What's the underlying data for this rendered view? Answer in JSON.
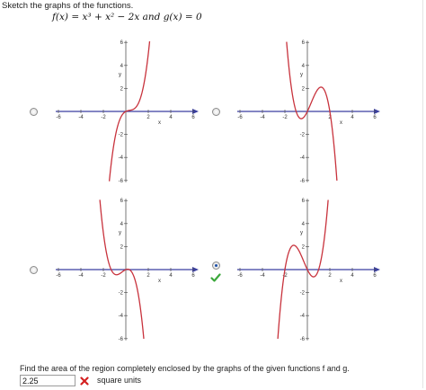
{
  "prompt": "Sketch the graphs of the functions.",
  "equation": "f(x) = x³ + x² − 2x and g(x) = 0",
  "axis": {
    "x_ticks": [
      "-6",
      "-4",
      "-2",
      "2",
      "4",
      "6"
    ],
    "y_ticks": [
      "6",
      "4",
      "2",
      "-2",
      "-4",
      "-6"
    ],
    "x_label": "x",
    "y_label": "y"
  },
  "choices": [
    {
      "id": "a",
      "selected": false,
      "correct": false
    },
    {
      "id": "b",
      "selected": false,
      "correct": false
    },
    {
      "id": "c",
      "selected": false,
      "correct": false
    },
    {
      "id": "d",
      "selected": true,
      "correct": true
    }
  ],
  "question": "Find the area of the region completely enclosed by the graphs of the given functions f and g.",
  "answer": {
    "value": "2.25",
    "status": "incorrect",
    "units": "square units"
  },
  "colors": {
    "curve": "#c8323c",
    "axis": "#3a3fa0",
    "correct": "#3ca83c",
    "incorrect": "#d42020"
  },
  "icons": {
    "correct": "check-icon",
    "incorrect": "x-icon"
  }
}
